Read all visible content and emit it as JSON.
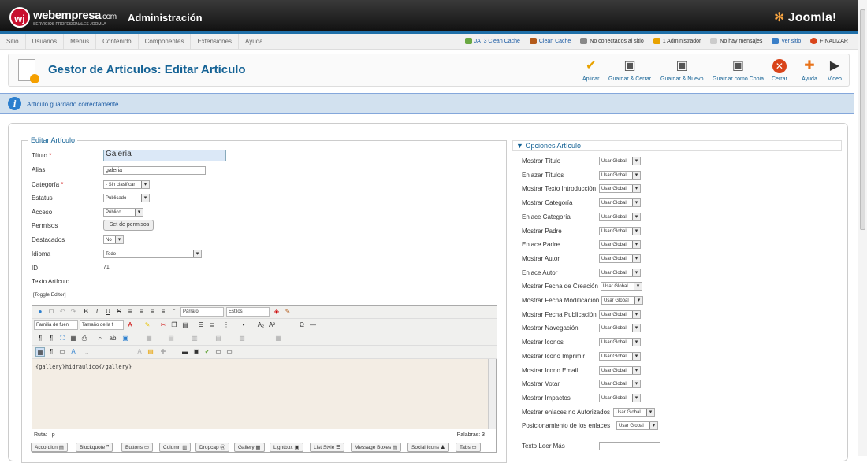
{
  "header": {
    "brand": "webempresa",
    "brand_suffix": ".com",
    "brand_sub": "SERVICIOS PROFESIONALES JOOMLA",
    "admin_title": "Administración",
    "joomla_logo": "Joomla!"
  },
  "menu": {
    "items": [
      "Sitio",
      "Usuarios",
      "Menús",
      "Contenido",
      "Componentes",
      "Extensiones",
      "Ayuda"
    ],
    "status": [
      "JAT3 Clean Cache",
      "Clean Cache",
      "No conectados al sitio",
      "1 Administrador",
      "No hay mensajes",
      "Ver sitio",
      "FINALIZAR"
    ]
  },
  "toolbar": {
    "title": "Gestor de Artículos: Editar Artículo",
    "buttons": [
      {
        "label": "Aplicar",
        "icon": "check-icon",
        "color": "#e8a200"
      },
      {
        "label": "Guardar & Cerrar",
        "icon": "save-icon",
        "color": "#555555"
      },
      {
        "label": "Guardar & Nuevo",
        "icon": "save-new-icon",
        "color": "#555555"
      },
      {
        "label": "Guardar como Copia",
        "icon": "save-copy-icon",
        "color": "#555555"
      },
      {
        "label": "Cerrar",
        "icon": "close-icon",
        "color": "#d9441a"
      },
      {
        "label": "Ayuda",
        "icon": "help-icon",
        "color": "#e8731a"
      },
      {
        "label": "Video",
        "icon": "video-icon",
        "color": "#333333"
      }
    ]
  },
  "message": "Artículo guardado correctamente.",
  "form": {
    "legend": "Editar Artículo",
    "labels": {
      "titulo": "Título",
      "alias": "Alias",
      "categoria": "Categoría",
      "estatus": "Estatus",
      "acceso": "Acceso",
      "permisos": "Permisos",
      "destacados": "Destacados",
      "idioma": "Idioma",
      "id": "ID",
      "texto": "Texto Artículo"
    },
    "required_mark": "*",
    "values": {
      "titulo": "Galería",
      "alias": "galeria",
      "categoria": "- Sin clasificar",
      "estatus": "Publicado",
      "acceso": "Público",
      "permisos": "Set de permisos",
      "destacados": "No",
      "idioma": "Todo",
      "id": "71"
    },
    "toggle_editor": "[Toggle Editor]"
  },
  "editor": {
    "paragraph": "Párrafo",
    "styles": "Estilos",
    "font_family": "Familia de fuen",
    "font_size": "Tamaño de la f",
    "content": "{gallery}hidraulico{/gallery}",
    "path_label": "Ruta:",
    "path_value": "p",
    "words_label": "Palabras: 3"
  },
  "plugins": [
    "Accordion",
    "Blockquote",
    "Buttons",
    "Column",
    "Dropcap",
    "Gallery",
    "Lightbox",
    "List Style",
    "Message Boxes",
    "Social Icons",
    "Tabs"
  ],
  "options": {
    "title": "Opciones Artículo",
    "default": "Usar Global",
    "rows": [
      "Mostrar Título",
      "Enlazar Títulos",
      "Mostrar Texto Introducción",
      "Mostrar Categoría",
      "Enlace Categoría",
      "Mostrar Padre",
      "Enlace Padre",
      "Mostrar Autor",
      "Enlace Autor",
      "Mostrar Fecha de Creación",
      "Mostrar Fecha Modificación",
      "Mostrar Fecha Publicación",
      "Mostrar Navegación",
      "Mostrar Iconos",
      "Mostrar Icono Imprimir",
      "Mostrar Icono Email",
      "Mostrar Votar",
      "Mostrar Impactos",
      "Mostrar enlaces no Autorizados",
      "Posicionamiento de los enlaces"
    ],
    "leer_mas": "Texto Leer Más"
  }
}
